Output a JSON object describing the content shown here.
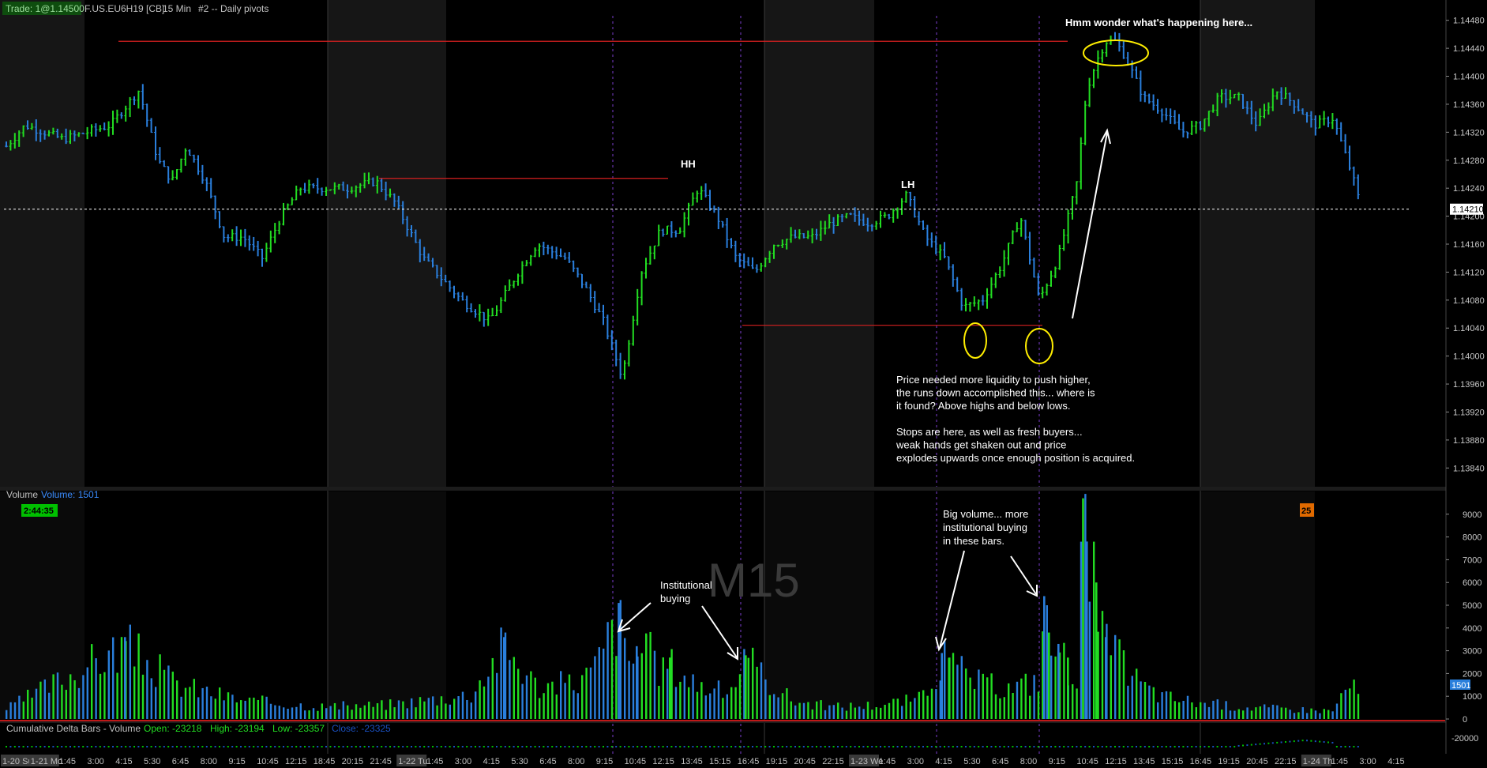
{
  "header": {
    "trade_label": "Trade: 1@1.14500",
    "symbol": "F.US.EU6H19 [CB]",
    "interval": "15 Min",
    "study": "#2 -- Daily pivots"
  },
  "colors": {
    "up": "#22dd22",
    "down": "#2a7fdc",
    "pivot_line": "#d42020",
    "annotation": "#ffffff",
    "highlight": "#ffee00",
    "grid": "#3a3a3a",
    "session_shade": "#151515",
    "delta_green": "#00c000",
    "delta_blue": "#1a50c0"
  },
  "price_panel": {
    "y_ticks": [
      "1.14480",
      "1.14440",
      "1.14400",
      "1.14360",
      "1.14320",
      "1.14280",
      "1.14240",
      "1.14200",
      "1.14160",
      "1.14120",
      "1.14080",
      "1.14040",
      "1.14000",
      "1.13960",
      "1.13920",
      "1.13880",
      "1.13840"
    ],
    "current_price": "1.14210",
    "current_price_value": 1.1421,
    "ylim": [
      1.1382,
      1.145
    ],
    "pivot_levels": [
      {
        "value": 1.1445
      },
      {
        "value": 1.14254
      },
      {
        "value": 1.14044
      }
    ],
    "annotations": {
      "hh": "HH",
      "lh": "LH",
      "wonder": "Hmm wonder what's happening here...",
      "liquidity_lines": [
        "Price needed more liquidity to push higher,",
        "the runs down accomplished this... where is",
        "it found?  Above highs and below lows.",
        "",
        "Stops are here, as well as fresh buyers...",
        "weak hands get shaken out and price",
        "explodes upwards once enough position is acquired."
      ]
    }
  },
  "volume_panel": {
    "title": "Volume",
    "value_label": "Volume: 1501",
    "timer": "2:44:35",
    "badge": "25",
    "last_volume": "1501",
    "watermark": "M15",
    "y_ticks": [
      "9000",
      "8000",
      "7000",
      "6000",
      "5000",
      "4000",
      "3000",
      "2000",
      "1000",
      "0"
    ],
    "annotations": {
      "institutional": [
        "Institutional",
        "buying"
      ],
      "big_volume": [
        "Big volume... more",
        "institutional buying",
        "in these bars."
      ]
    }
  },
  "delta_panel": {
    "title": "Cumulative Delta Bars - Volume",
    "open": "Open: -23218",
    "high": "High: -23194",
    "low": "Low: -23357",
    "close": "Close: -23325",
    "y_tick": "-20000"
  },
  "time_axis": {
    "labels": [
      {
        "t": "1-20 Su",
        "hl": true
      },
      {
        "t": "1-21 Mo",
        "hl": true
      },
      {
        "t": "1:45"
      },
      {
        "t": "3:00"
      },
      {
        "t": "4:15"
      },
      {
        "t": "5:30"
      },
      {
        "t": "6:45"
      },
      {
        "t": "8:00"
      },
      {
        "t": "9:15"
      },
      {
        "t": "10:45"
      },
      {
        "t": "12:15"
      },
      {
        "t": "18:45"
      },
      {
        "t": "20:15"
      },
      {
        "t": "21:45"
      },
      {
        "t": "1-22 Tu",
        "hl": true
      },
      {
        "t": "1:45"
      },
      {
        "t": "3:00"
      },
      {
        "t": "4:15"
      },
      {
        "t": "5:30"
      },
      {
        "t": "6:45"
      },
      {
        "t": "8:00"
      },
      {
        "t": "9:15"
      },
      {
        "t": "10:45"
      },
      {
        "t": "12:15"
      },
      {
        "t": "13:45"
      },
      {
        "t": "15:15"
      },
      {
        "t": "16:45"
      },
      {
        "t": "19:15"
      },
      {
        "t": "20:45"
      },
      {
        "t": "22:15"
      },
      {
        "t": "1-23 We",
        "hl": true
      },
      {
        "t": "1:45"
      },
      {
        "t": "3:00"
      },
      {
        "t": "4:15"
      },
      {
        "t": "5:30"
      },
      {
        "t": "6:45"
      },
      {
        "t": "8:00"
      },
      {
        "t": "9:15"
      },
      {
        "t": "10:45"
      },
      {
        "t": "12:15"
      },
      {
        "t": "13:45"
      },
      {
        "t": "15:15"
      },
      {
        "t": "16:45"
      },
      {
        "t": "19:15"
      },
      {
        "t": "20:45"
      },
      {
        "t": "22:15"
      },
      {
        "t": "1-24 Th",
        "hl": true
      },
      {
        "t": "1:45"
      },
      {
        "t": "3:00"
      },
      {
        "t": "4:15"
      }
    ]
  },
  "chart_data": {
    "type": "line",
    "title": "",
    "xlabel": "",
    "ylabel": "",
    "ylim": [
      1.1382,
      1.145
    ],
    "series": [
      {
        "x": [
          0,
          20,
          60,
          110,
          140,
          160,
          175,
          190,
          210,
          230,
          250,
          270,
          290,
          310,
          330,
          360,
          390,
          410,
          440,
          480,
          510,
          540,
          560,
          590,
          610,
          630,
          650,
          670,
          690,
          710,
          730,
          750,
          770,
          790,
          810,
          830,
          850,
          870,
          890,
          910,
          930,
          950,
          970,
          990,
          1010,
          1030,
          1050,
          1070,
          1090,
          1110,
          1130,
          1140,
          1150,
          1160,
          1170,
          1180,
          1190,
          1200,
          1220,
          1240,
          1260,
          1280,
          1300,
          1320,
          1340,
          1360,
          1380,
          1400,
          1420,
          1430
        ],
        "values": [
          1.143,
          1.1433,
          1.1431,
          1.1433,
          1.1438,
          1.1428,
          1.1425,
          1.143,
          1.1425,
          1.1417,
          1.1417,
          1.1414,
          1.142,
          1.1424,
          1.1424,
          1.1424,
          1.1425,
          1.1422,
          1.1414,
          1.1408,
          1.1405,
          1.1412,
          1.1416,
          1.1414,
          1.141,
          1.1405,
          1.1397,
          1.1412,
          1.1418,
          1.1418,
          1.1424,
          1.142,
          1.1414,
          1.1412,
          1.1416,
          1.1417,
          1.1417,
          1.1419,
          1.142,
          1.1419,
          1.142,
          1.1423,
          1.1417,
          1.1414,
          1.1407,
          1.1408,
          1.1413,
          1.142,
          1.1408,
          1.1414,
          1.1425,
          1.1438,
          1.1442,
          1.1445,
          1.1445,
          1.1443,
          1.144,
          1.1437,
          1.1435,
          1.1432,
          1.1433,
          1.1437,
          1.1437,
          1.1433,
          1.1438,
          1.1436,
          1.1433,
          1.1434,
          1.1426,
          1.1421
        ]
      }
    ],
    "volume": {
      "x": [
        0,
        125,
        180,
        250,
        340,
        400,
        490,
        525,
        560,
        600,
        620,
        646,
        655,
        665,
        675,
        685,
        700,
        720,
        740,
        760,
        780,
        830,
        870,
        920,
        965,
        987,
        995,
        1030,
        1060,
        1080,
        1090,
        1095,
        1100,
        1110,
        1120,
        1130,
        1136,
        1140,
        1150,
        1160,
        1180,
        1200,
        1220,
        1260,
        1300,
        1350,
        1400,
        1415,
        1430,
        1436
      ],
      "values": [
        500,
        3600,
        1700,
        900,
        600,
        700,
        1200,
        3600,
        1600,
        1800,
        2400,
        5100,
        2600,
        3200,
        3700,
        2400,
        2700,
        2000,
        1500,
        1300,
        2800,
        900,
        600,
        700,
        1000,
        2900,
        2700,
        1700,
        1500,
        1800,
        2000,
        5400,
        3800,
        3300,
        2700,
        2300,
        9700,
        7800,
        6000,
        3600,
        2600,
        1600,
        1100,
        800,
        600,
        500,
        400,
        1700,
        1200,
        1500
      ]
    }
  }
}
